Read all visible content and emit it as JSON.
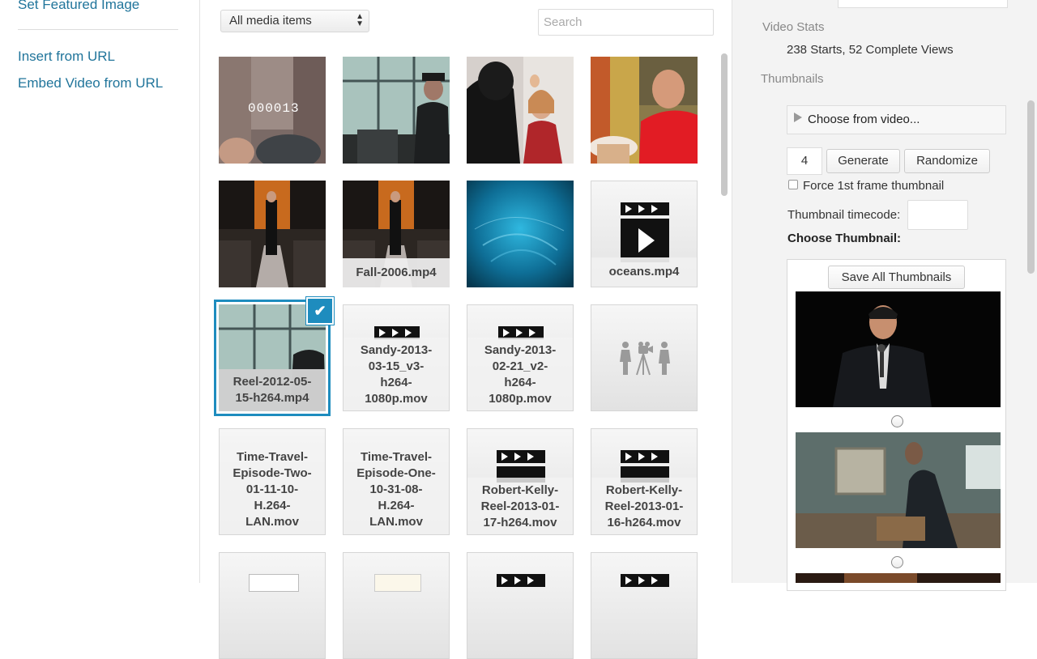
{
  "sidebar": {
    "set_featured": "Set Featured Image",
    "insert_url": "Insert from URL",
    "embed_url": "Embed Video from URL"
  },
  "toolbar": {
    "filter_selected": "All media items",
    "search_placeholder": "Search"
  },
  "media": {
    "fall_caption": "Fall-2006.mp4",
    "oceans_caption": "oceans.mp4",
    "reel_caption": "Reel-2012-05-\n15-h264.mp4",
    "sandy1_caption": "Sandy-2013-\n03-15_v3-\nh264-\n1080p.mov",
    "sandy2_caption": "Sandy-2013-\n02-21_v2-\nh264-\n1080p.mov",
    "time_two_caption": "Time-Travel-\nEpisode-Two-\n01-11-10-\nH.264-\nLAN.mov",
    "time_one_caption": "Time-Travel-\nEpisode-One-\n10-31-08-\nH.264-\nLAN.mov",
    "robert17_caption": "Robert-Kelly-\nReel-2013-01-\n17-h264.mov",
    "robert16_caption": "Robert-Kelly-\nReel-2013-01-\n16-h264.mov",
    "overlay_number": "000013",
    "selected_check": "✔"
  },
  "panel": {
    "video_stats_label": "Video Stats",
    "video_stats_value": "238 Starts, 52 Complete Views",
    "thumbnails_label": "Thumbnails",
    "choose_from_video": "Choose from video...",
    "thumb_count": "4",
    "generate": "Generate",
    "randomize": "Randomize",
    "force_first_frame": "Force 1st frame thumbnail",
    "timecode_label": "Thumbnail timecode:",
    "choose_thumbnail": "Choose Thumbnail:",
    "save_all": "Save All Thumbnails"
  },
  "icons": {
    "select_arrows": "up-down-arrows-icon",
    "video": "video-clapper-icon",
    "generic": "people-camera-icon",
    "play": "play-triangle-icon"
  },
  "colors": {
    "link": "#21759b",
    "selection": "#1e8cbe",
    "panel_bg": "#f3f3f3"
  }
}
